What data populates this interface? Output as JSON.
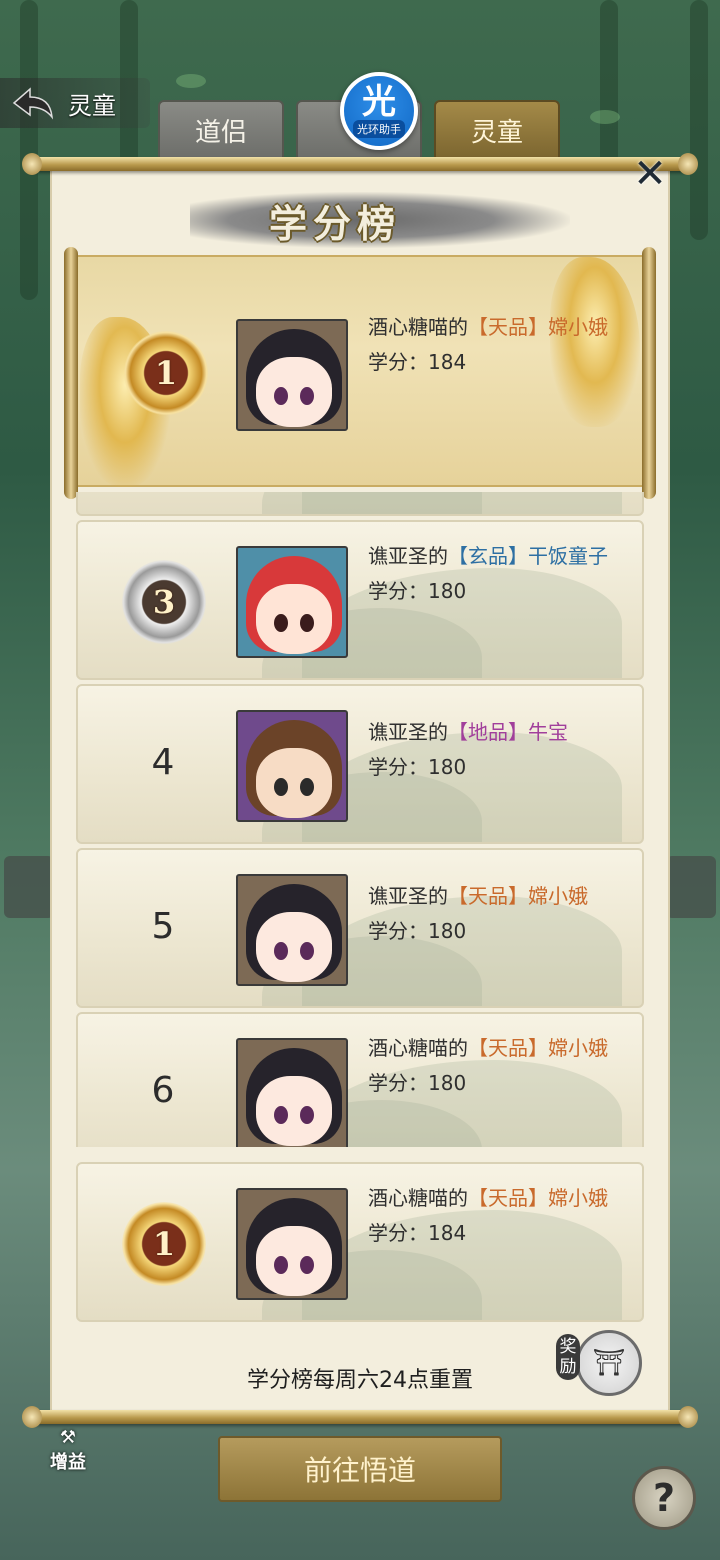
{
  "header": {
    "back_title": "灵童",
    "tabs": [
      {
        "label": "道侣",
        "active": false
      },
      {
        "label": "",
        "active": false
      },
      {
        "label": "灵童",
        "active": true
      }
    ],
    "badge": {
      "big": "光",
      "small": "光环助手"
    }
  },
  "panel": {
    "title": "学分榜",
    "close": "✕"
  },
  "top_entry": {
    "rank": "1",
    "owner": "酒心糖喵的",
    "quality": "【天品】",
    "name": "嫦小娥",
    "score_label": "学分：",
    "score": "184"
  },
  "rows": [
    {
      "rank": "3",
      "medal": "silver",
      "owner": "谯亚圣的",
      "quality": "【玄品】",
      "quality_type": "mystic",
      "name": "干饭童子",
      "score_label": "学分：",
      "score": "180"
    },
    {
      "rank": "4",
      "medal": "",
      "owner": "谯亚圣的",
      "quality": "【地品】",
      "quality_type": "earth",
      "name": "牛宝",
      "score_label": "学分：",
      "score": "180"
    },
    {
      "rank": "5",
      "medal": "",
      "owner": "谯亚圣的",
      "quality": "【天品】",
      "quality_type": "heaven",
      "name": "嫦小娥",
      "score_label": "学分：",
      "score": "180"
    },
    {
      "rank": "6",
      "medal": "",
      "owner": "酒心糖喵的",
      "quality": "【天品】",
      "quality_type": "heaven",
      "name": "嫦小娥",
      "score_label": "学分：",
      "score": "180"
    }
  ],
  "my_entry": {
    "rank": "1",
    "owner": "酒心糖喵的",
    "quality": "【天品】",
    "name": "嫦小娥",
    "score_label": "学分：",
    "score": "184"
  },
  "footer": {
    "reset_note": "学分榜每周六24点重置",
    "reward_label": "奖励"
  },
  "bottom": {
    "go_button": "前往悟道",
    "buff_label": "增益",
    "help": "?"
  },
  "colors": {
    "heaven": "#c96a2c",
    "mystic": "#2d6fa3",
    "earth": "#a13f9b",
    "gold_tab": "#a48a48"
  }
}
